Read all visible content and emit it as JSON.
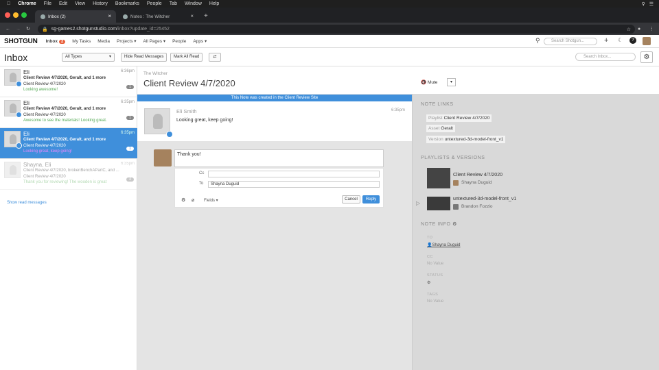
{
  "menubar": {
    "apple": "",
    "app": "Chrome",
    "items": [
      "File",
      "Edit",
      "View",
      "History",
      "Bookmarks",
      "People",
      "Tab",
      "Window",
      "Help"
    ]
  },
  "tabs": [
    {
      "label": "Inbox (2)",
      "close": "×"
    },
    {
      "label": "Notes : The Witcher",
      "close": "×"
    }
  ],
  "new_tab": "+",
  "address": {
    "url": "sg-games2.shotgunstudio.com/inbox?update_id=25452",
    "url_main": "sg-games2.shotgunstudio.com",
    "url_rest": "/inbox?update_id=25452"
  },
  "topnav": {
    "logo": "SHOTGUN",
    "inbox": "Inbox",
    "inbox_badge": "2",
    "items": [
      "My Tasks",
      "Media",
      "Projects ▾",
      "All Pages ▾",
      "People",
      "Apps ▾"
    ],
    "search_placeholder": "Search Shotgun..."
  },
  "toolbar": {
    "title": "Inbox",
    "filter": "All Types",
    "hide_read": "Hide Read Messages",
    "mark_all": "Mark All Read",
    "search_placeholder": "Search Inbox..."
  },
  "messages": [
    {
      "name": "Eli",
      "time": "6:36pm",
      "subject": "Client Review 4/7/2020, Geralt, and 1 more",
      "line2": "Client Review 4/7/2020",
      "line3": "Looking awesome!",
      "count": "1",
      "state": "normal"
    },
    {
      "name": "Eli",
      "time": "6:35pm",
      "subject": "Client Review 4/7/2020, Geralt, and 1 more",
      "line2": "Client Review 4/7/2020",
      "line3": "Awesome to see the materials! Looking great.",
      "count": "1",
      "state": "normal"
    },
    {
      "name": "Eli",
      "time": "6:35pm",
      "subject": "Client Review 4/7/2020, Geralt, and 1 more",
      "line2": "Client Review 4/7/2020",
      "line3": "Looking great, keep going!",
      "count": "1",
      "state": "selected"
    },
    {
      "name": "Shayna, Eli",
      "time": "6:35pm",
      "subject": "Client Review 4/7/2020, brokenBenchAPartC, and ...",
      "line2": "Client Review 4/7/2020",
      "line3": "Thank you for reviewing! The wooden is great",
      "count": "4",
      "state": "read"
    }
  ],
  "show_read": "Show read messages",
  "note": {
    "project": "The Witcher",
    "title": "Client Review 4/7/2020",
    "mute": "Mute",
    "banner": "This Note was created in the Client Review Site",
    "author": "Eli Smith",
    "time": "6:35pm",
    "body": "Looking great, keep going!"
  },
  "reply": {
    "text": "Thank you!",
    "cc_label": "Cc",
    "to_label": "To",
    "to_value": "Shayna Duguid",
    "fields": "Fields ▾",
    "cancel": "Cancel",
    "reply": "Reply"
  },
  "note_links": {
    "heading": "NOTE LINKS",
    "items": [
      {
        "type": "Playlist",
        "value": "Client Review 4/7/2020"
      },
      {
        "type": "Asset",
        "value": "Geralt"
      },
      {
        "type": "Version",
        "value": "untextured-3d-model-front_v1"
      }
    ]
  },
  "playlists": {
    "heading": "PLAYLISTS & VERSIONS",
    "items": [
      {
        "title": "Client Review 4/7/2020",
        "user": "Shayna Duguid"
      },
      {
        "title": "untextured-3d-model-front_v1",
        "user": "Brandon Fozzio"
      }
    ]
  },
  "note_info": {
    "heading": "NOTE INFO",
    "to_label": "TO",
    "to_value": "Shayna Duguid",
    "cc_label": "CC",
    "cc_value": "No Value",
    "status_label": "STATUS",
    "tags_label": "TAGS",
    "tags_value": "No Value"
  }
}
